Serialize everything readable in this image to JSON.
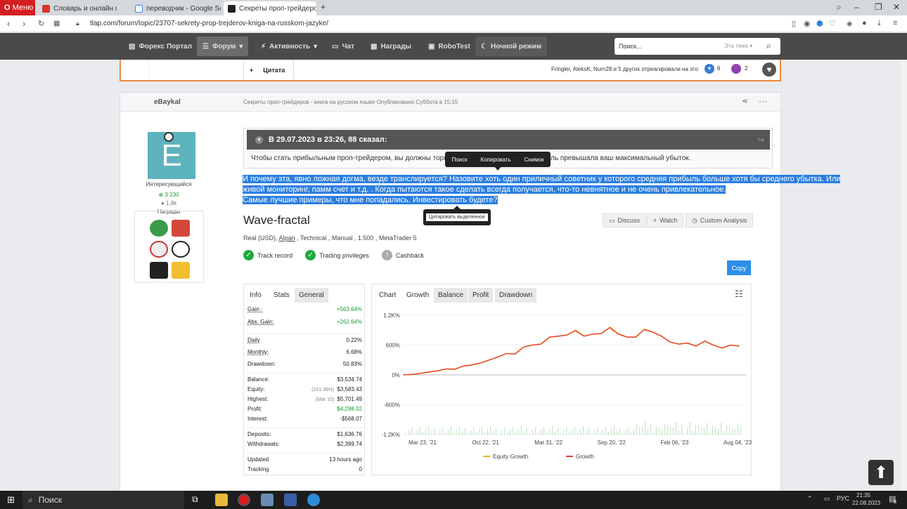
{
  "browser": {
    "menu_label": "Меню",
    "tabs": [
      {
        "label": "Словарь и онлайн перево...",
        "color": "#d8362d"
      },
      {
        "label": "переводчик - Google Searc...",
        "color": "#4285f4"
      },
      {
        "label": "Секреты проп-трейдеров ...",
        "color": "#222222"
      }
    ],
    "url": "tlap.com/forum/topic/23707-sekrety-prop-trejderov-kniga-na-russkom-jazyke/"
  },
  "sitenav": {
    "items": [
      "Форекс Портал",
      "Форум",
      "Активность",
      "Чат",
      "Награды",
      "RoboTest",
      "Ночной режим"
    ],
    "search_placeholder": "Поиск...",
    "search_scope": "Эта тема"
  },
  "prev_post": {
    "quote_label": "Цитата",
    "reactions_text": "Fringler, AleksK, Nurn28 и 5 других отреагировали на это",
    "like_count": "6",
    "other_count": "2"
  },
  "post": {
    "author": "eBaykal",
    "meta": "Секреты проп-трейдеров - книга на русском языке Опубликовано Суббота в 15:15",
    "avatar_letter": "E",
    "rank": "Интересующийся",
    "reputation": "3 230",
    "posts": "1,8k",
    "awards_label": "Награды",
    "quote_header": "В 29.07.2023 в 23:26, 88 сказал:",
    "quote_text_start": "Чтобы стать прибыльным проп-трейдером, вы должны торгова",
    "quote_text_end": "ль превышала ваш максимальный убыток.",
    "context_menu": [
      "Поиск",
      "Копировать",
      "Снимок"
    ],
    "selected_lines": [
      "И почему эта, явно ложная догма, везде транслируется? Назовите хоть один приличный советник у которого средняя прибыль больше хотя бы среднего убытка. Или",
      "живой мониторинг, памм счет и т.д. . Когда пытаются такое сделать всегда получается, что-то невнятное и не очень привлекательное.",
      "Самые лучшие примеры, что мне попадались. Инвестировать будете?"
    ],
    "quote_selection_btn": "Цитировать выделенное"
  },
  "widget": {
    "title": "Wave-fractal",
    "subtitle_pre": "Real (USD), ",
    "broker": "Alpari",
    "subtitle_post": " , Technical , Manual , 1:500 , MetaTrader 5",
    "badges": [
      "Track record",
      "Trading privileges",
      "Cashback"
    ],
    "actions": [
      "Discuss",
      "Watch",
      "Custom Analysis"
    ],
    "copy_label": "Copy",
    "info_tabs": [
      "Info",
      "Stats",
      "General"
    ],
    "stats": [
      {
        "label": "Gain :",
        "value": "+563.64%",
        "green": true,
        "u": true
      },
      {
        "label": "Abs. Gain:",
        "value": "+262.64%",
        "green": true,
        "u": true
      },
      {
        "label": "Daily",
        "value": "0.22%",
        "u": true
      },
      {
        "label": "Monthly:",
        "value": "6.68%",
        "u": true
      },
      {
        "label": "Drawdown:",
        "value": "50.83%"
      },
      {
        "label": "Balance:",
        "value": "$3,534.74"
      },
      {
        "label": "Equity:",
        "pre": "(101.38%)",
        "value": "$3,583.43"
      },
      {
        "label": "Highest:",
        "pre": "(Mar 10)",
        "value": "$5,701.49"
      },
      {
        "label": "Profit:",
        "value": "$4,298.02",
        "green": true
      },
      {
        "label": "Interest:",
        "value": "-$568.07"
      },
      {
        "label": "Deposits:",
        "value": "$1,636.76"
      },
      {
        "label": "Withdrawals:",
        "value": "$2,399.74"
      },
      {
        "label": "Updated",
        "value": "13 hours ago"
      },
      {
        "label": "Tracking",
        "value": "0"
      }
    ],
    "chart_tabs": [
      "Chart",
      "Growth",
      "Balance",
      "Profit",
      "Drawdown"
    ]
  },
  "chart_data": {
    "type": "line",
    "x_ticks": [
      "Mar 23, '21",
      "Oct 22, '21",
      "Mar 31, '22",
      "Sep 20, '22",
      "Feb 06, '23",
      "Aug 04, '23"
    ],
    "y_ticks": [
      "1.2K%",
      "600%",
      "0%",
      "-600%",
      "-1.2K%"
    ],
    "ylim": [
      -1200,
      1200
    ],
    "series": [
      {
        "name": "Equity Growth",
        "color": "#f3b01e",
        "values": [
          0,
          10,
          30,
          60,
          80,
          120,
          120,
          180,
          200,
          240,
          300,
          360,
          430,
          420,
          560,
          600,
          620,
          760,
          780,
          800,
          900,
          780,
          820,
          830,
          960,
          820,
          760,
          760,
          920,
          860,
          780,
          660,
          620,
          640,
          580,
          680,
          600,
          540,
          600,
          580
        ]
      },
      {
        "name": "Growth",
        "color": "#e53b2f",
        "values": [
          0,
          10,
          30,
          60,
          80,
          120,
          110,
          180,
          200,
          240,
          300,
          360,
          430,
          420,
          560,
          600,
          620,
          760,
          780,
          800,
          890,
          780,
          820,
          830,
          950,
          820,
          760,
          760,
          910,
          860,
          780,
          660,
          620,
          640,
          580,
          680,
          600,
          540,
          600,
          580
        ]
      }
    ],
    "legend_position": "bottom"
  },
  "taskbar": {
    "search": "Поиск",
    "time": "21:35",
    "date": "22.08.2023",
    "lang": "РУС",
    "notify_count": "8"
  }
}
